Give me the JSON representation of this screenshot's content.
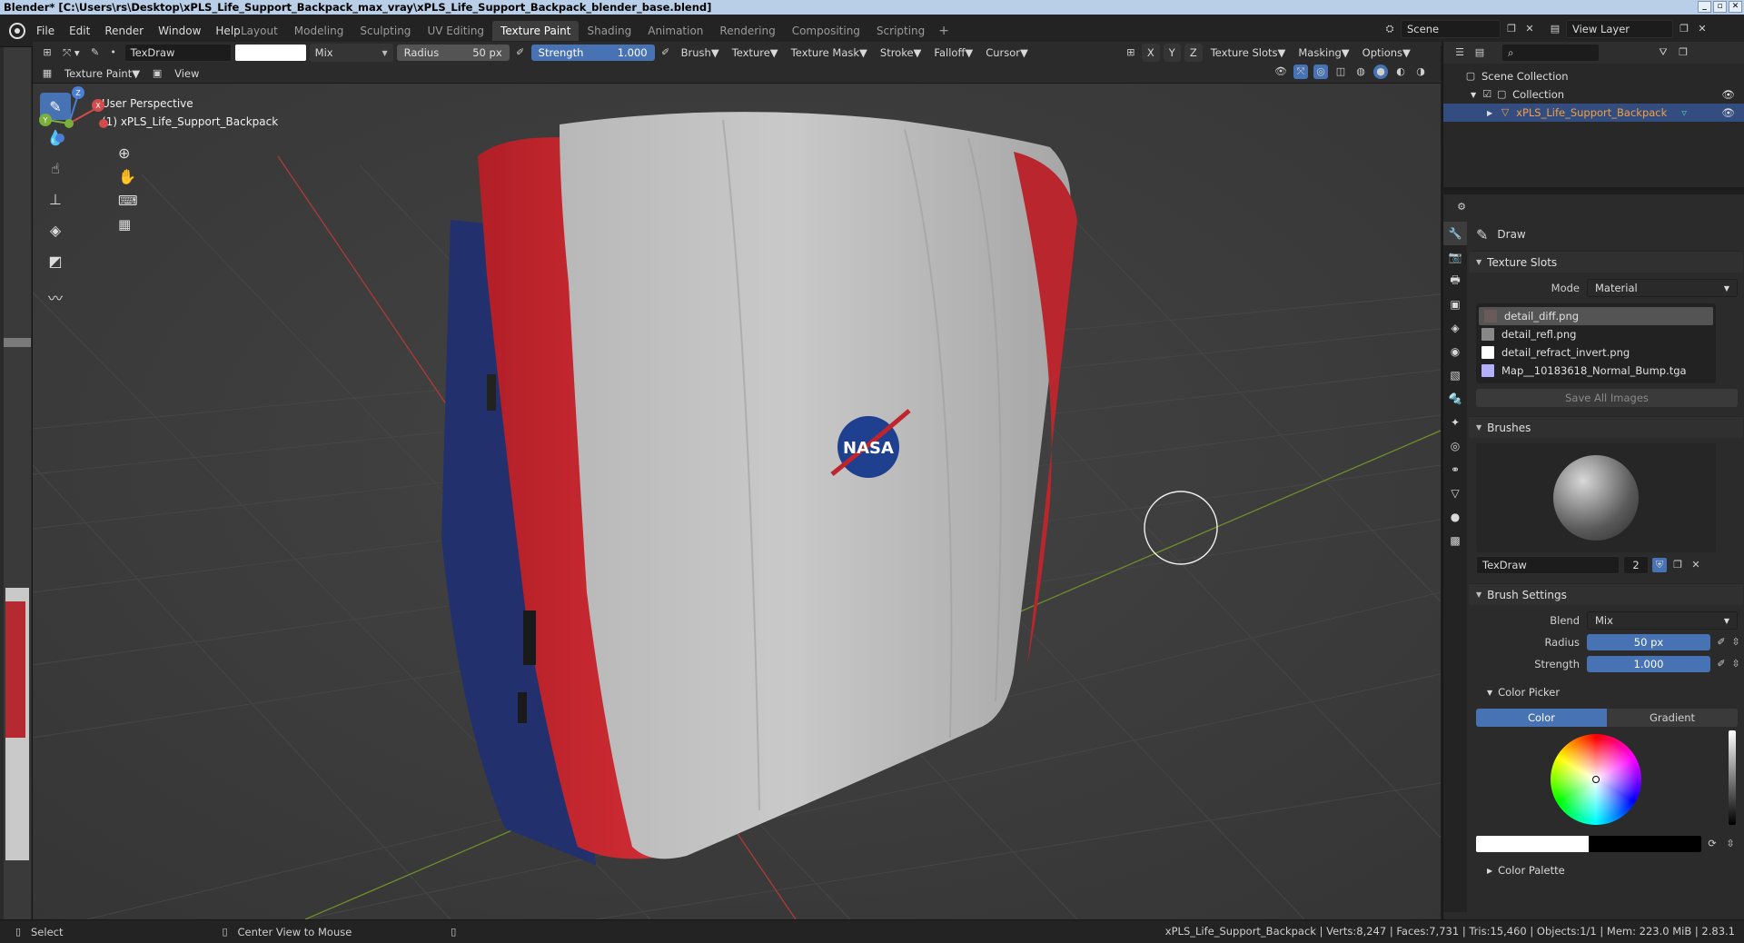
{
  "title_bar": {
    "text": "Blender* [C:\\Users\\rs\\Desktop\\xPLS_Life_Support_Backpack_max_vray\\xPLS_Life_Support_Backpack_blender_base.blend]"
  },
  "menus": [
    "File",
    "Edit",
    "Render",
    "Window",
    "Help"
  ],
  "workspaces": [
    {
      "label": "Layout",
      "active": false
    },
    {
      "label": "Modeling",
      "active": false
    },
    {
      "label": "Sculpting",
      "active": false
    },
    {
      "label": "UV Editing",
      "active": false
    },
    {
      "label": "Texture Paint",
      "active": true
    },
    {
      "label": "Shading",
      "active": false
    },
    {
      "label": "Animation",
      "active": false
    },
    {
      "label": "Rendering",
      "active": false
    },
    {
      "label": "Compositing",
      "active": false
    },
    {
      "label": "Scripting",
      "active": false
    }
  ],
  "scene": {
    "label": "Scene",
    "view_layer": "View Layer"
  },
  "tool_header": {
    "brush_name": "TexDraw",
    "blend_mode": "Mix",
    "radius_label": "Radius",
    "radius_value": "50 px",
    "strength_label": "Strength",
    "strength_value": "1.000",
    "dropdowns": [
      "Brush",
      "Texture",
      "Texture Mask",
      "Stroke",
      "Falloff",
      "Cursor"
    ],
    "axes": [
      "X",
      "Y",
      "Z"
    ],
    "right_dropdowns": [
      "Texture Slots",
      "Masking",
      "Options"
    ]
  },
  "view_header": {
    "mode": "Texture Paint",
    "view": "View"
  },
  "viewport": {
    "perspective": "User Perspective",
    "object_label": "(1) xPLS_Life_Support_Backpack",
    "logo_text": "NASA"
  },
  "outliner": {
    "root": "Scene Collection",
    "collection": "Collection",
    "object": "xPLS_Life_Support_Backpack"
  },
  "properties": {
    "tool_name": "Draw",
    "texture_slots_title": "Texture Slots",
    "mode_label": "Mode",
    "mode_value": "Material",
    "slots": [
      {
        "name": "detail_diff.png",
        "selected": true,
        "thumb": "#6a5a5a"
      },
      {
        "name": "detail_refl.png",
        "selected": false,
        "thumb": "#888888"
      },
      {
        "name": "detail_refract_invert.png",
        "selected": false,
        "thumb": "#ffffff"
      },
      {
        "name": "Map__10183618_Normal_Bump.tga",
        "selected": false,
        "thumb": "#b4b0ff"
      }
    ],
    "save_all": "Save All Images",
    "brushes_title": "Brushes",
    "brush_name": "TexDraw",
    "brush_users": "2",
    "brush_settings_title": "Brush Settings",
    "blend_label": "Blend",
    "blend_value": "Mix",
    "radius_label": "Radius",
    "radius_value": "50 px",
    "strength_label": "Strength",
    "strength_value": "1.000",
    "color_picker_title": "Color Picker",
    "color_tab": "Color",
    "gradient_tab": "Gradient",
    "color_palette_title": "Color Palette"
  },
  "status_bar": {
    "select": "Select",
    "center_view": "Center View to Mouse",
    "stats": "xPLS_Life_Support_Backpack | Verts:8,247 | Faces:7,731 | Tris:15,460 | Objects:1/1 | Mem: 223.0 MiB | 2.83.1"
  },
  "colors": {
    "accent": "#4772b3",
    "selection": "#334d80",
    "backpack_red": "#c0242c",
    "backpack_blue": "#23306e",
    "backpack_body": "#bdbdbd"
  }
}
